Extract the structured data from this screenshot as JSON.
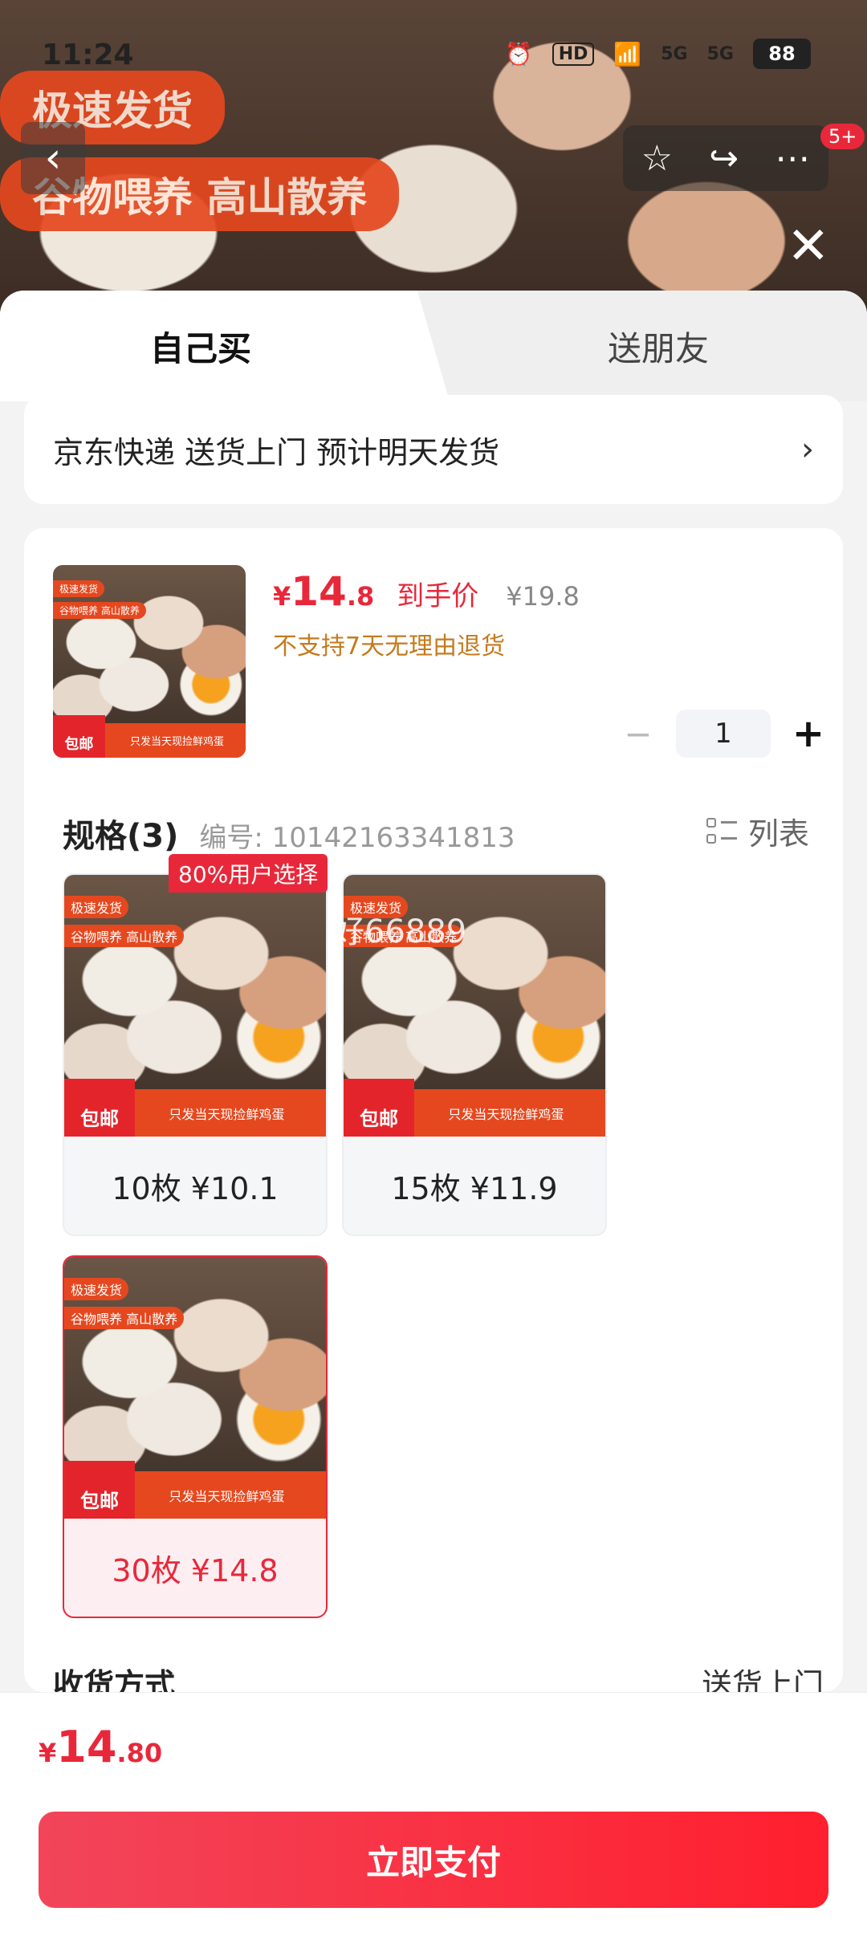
{
  "status_bar": {
    "time": "11:24",
    "battery": "88",
    "hd": "HD",
    "net1": "5G",
    "net2": "5G"
  },
  "hero": {
    "tag1": "极速发货",
    "tag2": "谷物喂养 高山散养",
    "more_badge": "5+"
  },
  "tabs": {
    "self": "自己买",
    "friend": "送朋友"
  },
  "delivery": {
    "text": "京东快递 送货上门 预计明天发货"
  },
  "product": {
    "price_symbol": "¥",
    "price_int": "14",
    "price_dec": ".8",
    "price_label": "到手价",
    "original_price": "¥19.8",
    "return_policy": "不支持7天无理由退货",
    "quantity": "1"
  },
  "thumb_text": {
    "t1": "极速发货",
    "t2": "谷物喂养 高山散养",
    "ribbon": "只发当天现捡鲜鸡蛋",
    "jd": "包邮"
  },
  "spec": {
    "title": "规格(3)",
    "code": "编号: 10142163341813",
    "list_label": "列表",
    "popular": "80%用户选择",
    "options": [
      {
        "label": "10枚  ¥10.1"
      },
      {
        "label": "15枚  ¥11.9"
      },
      {
        "label": "30枚  ¥14.8"
      }
    ]
  },
  "watermark": "好66889",
  "receive": {
    "title": "收货方式",
    "value": "送货上门"
  },
  "footer": {
    "symbol": "¥",
    "int": "14",
    "dec": ".80",
    "pay_label": "立即支付"
  }
}
